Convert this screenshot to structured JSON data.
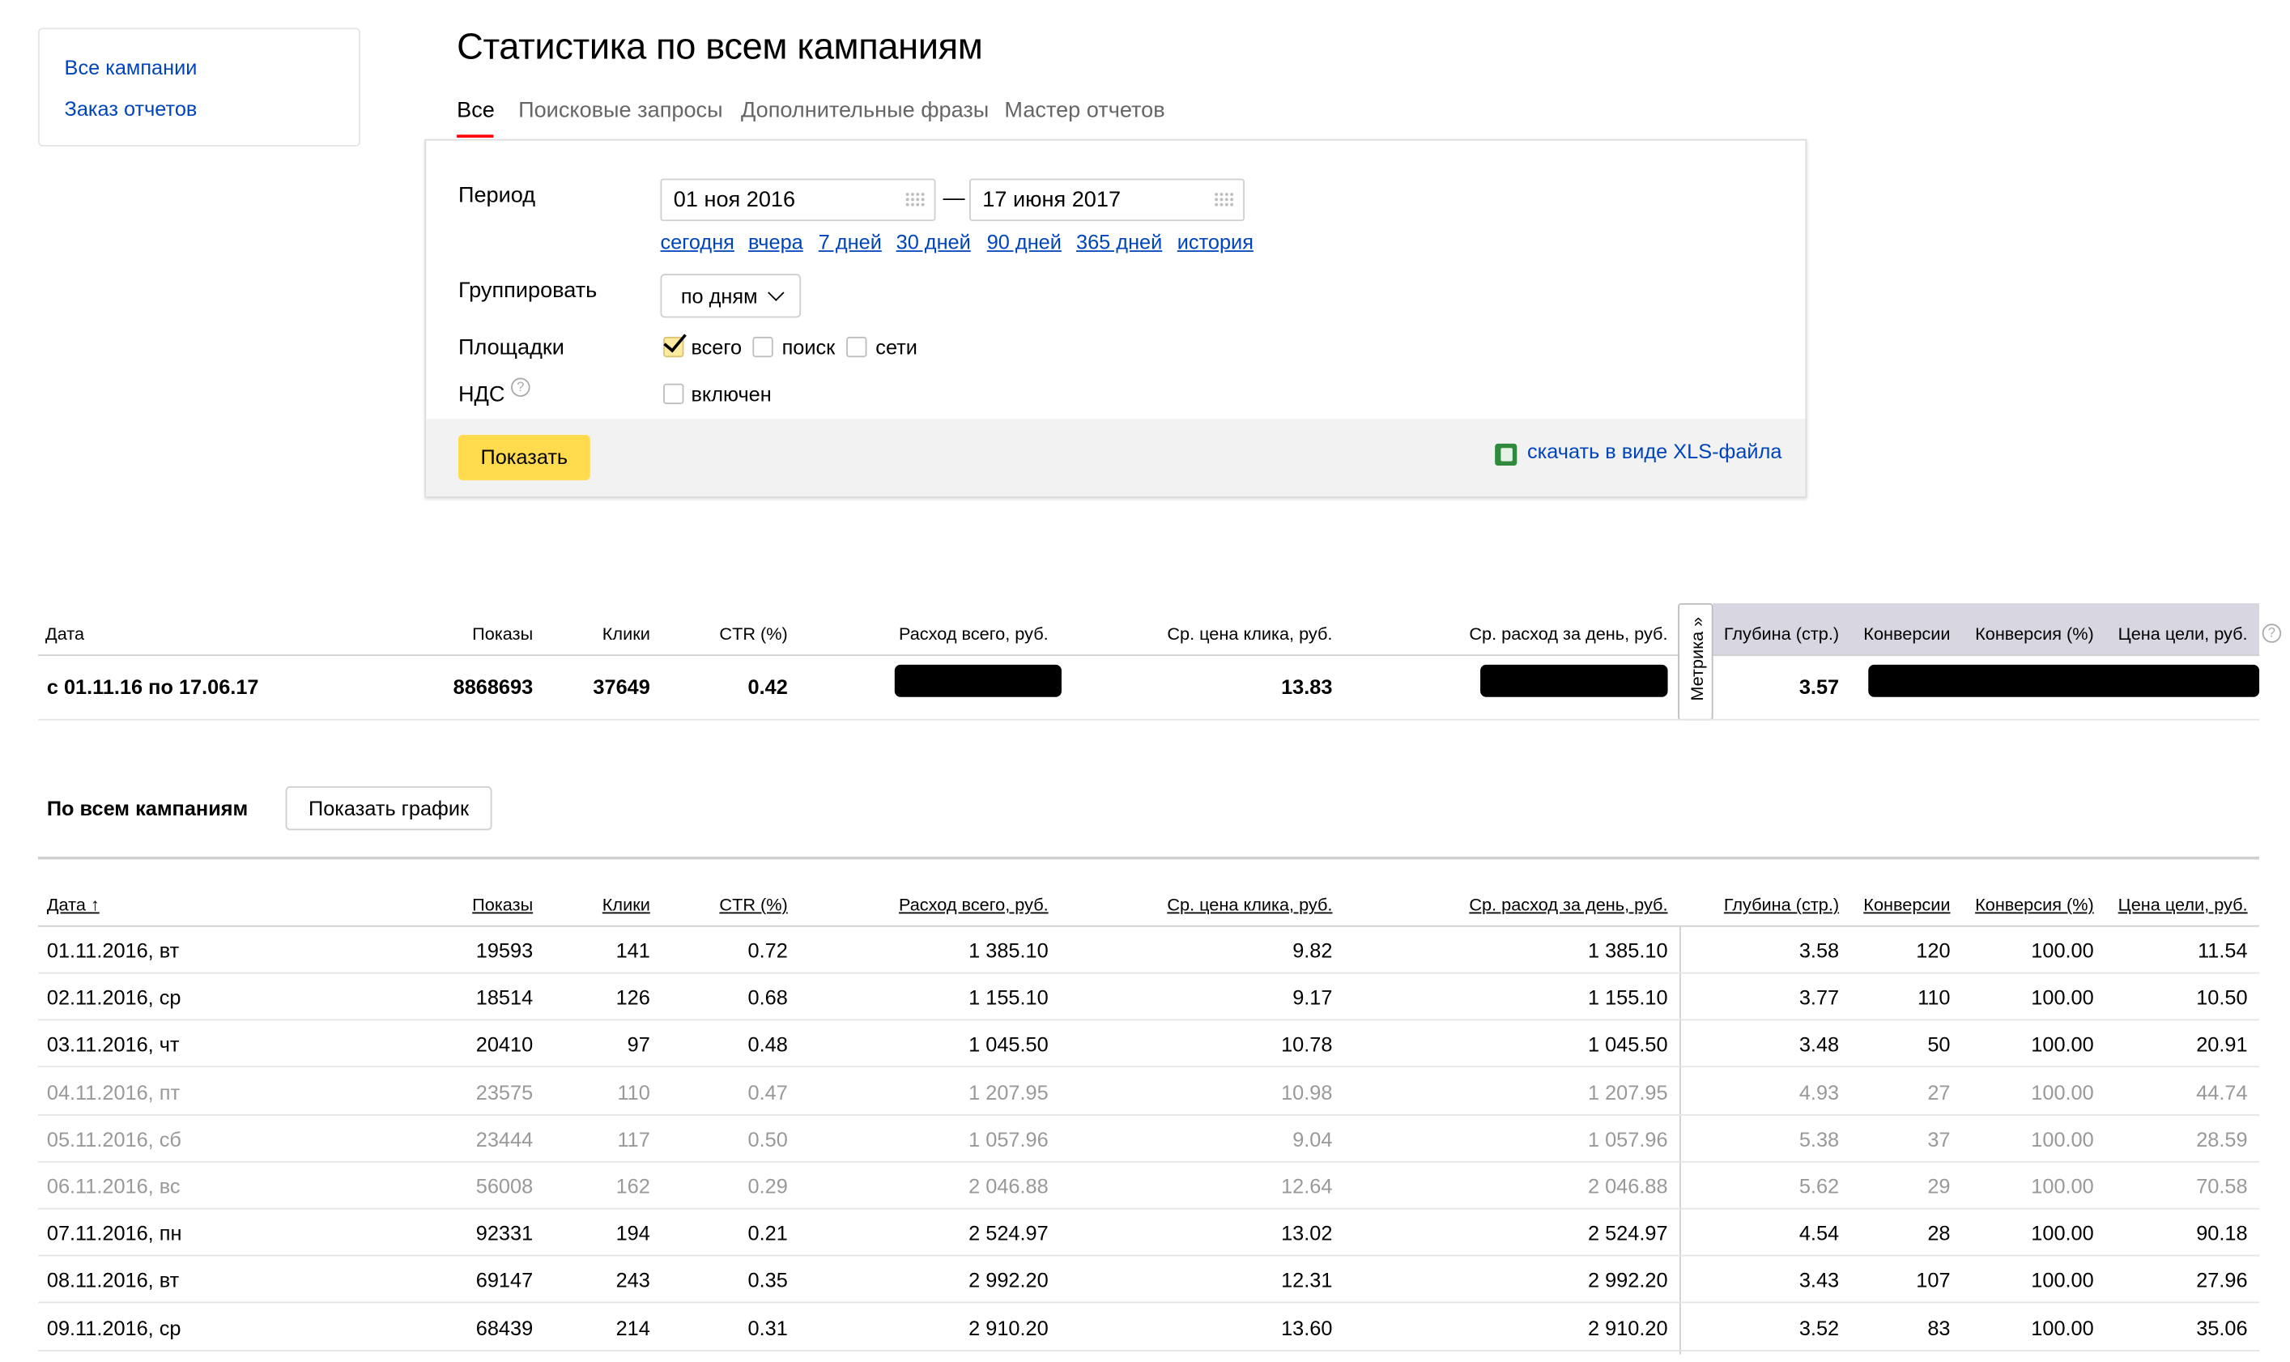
{
  "sidebar": {
    "links": [
      "Все кампании",
      "Заказ отчетов"
    ]
  },
  "page": {
    "title": "Статистика по всем кампаниям"
  },
  "tabs": [
    {
      "label": "Все",
      "active": true
    },
    {
      "label": "Поисковые запросы",
      "active": false
    },
    {
      "label": "Дополнительные фразы",
      "active": false
    },
    {
      "label": "Мастер отчетов",
      "active": false
    }
  ],
  "filters": {
    "period_label": "Период",
    "date_from": "01 ноя 2016",
    "date_sep": "—",
    "date_to": "17 июня 2017",
    "quick_periods": [
      "сегодня",
      "вчера",
      "7 дней",
      "30 дней",
      "90 дней",
      "365 дней",
      "история"
    ],
    "group_label": "Группировать",
    "group_value": "по дням",
    "platforms_label": "Площадки",
    "platforms": [
      {
        "label": "всего",
        "checked": true
      },
      {
        "label": "поиск",
        "checked": false
      },
      {
        "label": "сети",
        "checked": false
      }
    ],
    "vat_label": "НДС",
    "vat_option": {
      "label": "включен",
      "checked": false
    },
    "show_button": "Показать",
    "download_link": "скачать в виде XLS-файла"
  },
  "colors": {
    "accent_yellow": "#ffdb4d",
    "link": "#0044bb",
    "tab_active_underline": "#ff0000",
    "metrika_header_bg": "#d8d6e0",
    "muted_row_text": "#999999"
  },
  "summary": {
    "headers": [
      "Дата",
      "Показы",
      "Клики",
      "CTR (%)",
      "Расход всего, руб.",
      "Ср. цена клика, руб.",
      "Ср. расход за день, руб.",
      "Глубина (стр.)",
      "Конверсии",
      "Конверсия (%)",
      "Цена цели, руб."
    ],
    "metrika_label": "Метрика »",
    "row": {
      "date": "с 01.11.16 по 17.06.17",
      "shows": "8868693",
      "clicks": "37649",
      "ctr": "0.42",
      "cpc": "13.83",
      "depth": "3.57"
    }
  },
  "campaign": {
    "title": "По всем кампаниям",
    "chart_button": "Показать график"
  },
  "table": {
    "headers": [
      "Дата ↑",
      "Показы",
      "Клики",
      "CTR (%)",
      "Расход всего, руб.",
      "Ср. цена клика, руб.",
      "Ср. расход за день, руб.",
      "Глубина (стр.)",
      "Конверсии",
      "Конверсия (%)",
      "Цена цели, руб."
    ],
    "rows": [
      {
        "muted": false,
        "cells": [
          "01.11.2016, вт",
          "19593",
          "141",
          "0.72",
          "1 385.10",
          "9.82",
          "1 385.10",
          "3.58",
          "120",
          "100.00",
          "11.54"
        ]
      },
      {
        "muted": false,
        "cells": [
          "02.11.2016, ср",
          "18514",
          "126",
          "0.68",
          "1 155.10",
          "9.17",
          "1 155.10",
          "3.77",
          "110",
          "100.00",
          "10.50"
        ]
      },
      {
        "muted": false,
        "cells": [
          "03.11.2016, чт",
          "20410",
          "97",
          "0.48",
          "1 045.50",
          "10.78",
          "1 045.50",
          "3.48",
          "50",
          "100.00",
          "20.91"
        ]
      },
      {
        "muted": true,
        "cells": [
          "04.11.2016, пт",
          "23575",
          "110",
          "0.47",
          "1 207.95",
          "10.98",
          "1 207.95",
          "4.93",
          "27",
          "100.00",
          "44.74"
        ]
      },
      {
        "muted": true,
        "cells": [
          "05.11.2016, сб",
          "23444",
          "117",
          "0.50",
          "1 057.96",
          "9.04",
          "1 057.96",
          "5.38",
          "37",
          "100.00",
          "28.59"
        ]
      },
      {
        "muted": true,
        "cells": [
          "06.11.2016, вс",
          "56008",
          "162",
          "0.29",
          "2 046.88",
          "12.64",
          "2 046.88",
          "5.62",
          "29",
          "100.00",
          "70.58"
        ]
      },
      {
        "muted": false,
        "cells": [
          "07.11.2016, пн",
          "92331",
          "194",
          "0.21",
          "2 524.97",
          "13.02",
          "2 524.97",
          "4.54",
          "28",
          "100.00",
          "90.18"
        ]
      },
      {
        "muted": false,
        "cells": [
          "08.11.2016, вт",
          "69147",
          "243",
          "0.35",
          "2 992.20",
          "12.31",
          "2 992.20",
          "3.43",
          "107",
          "100.00",
          "27.96"
        ]
      },
      {
        "muted": false,
        "cells": [
          "09.11.2016, ср",
          "68439",
          "214",
          "0.31",
          "2 910.20",
          "13.60",
          "2 910.20",
          "3.52",
          "83",
          "100.00",
          "35.06"
        ]
      }
    ]
  }
}
